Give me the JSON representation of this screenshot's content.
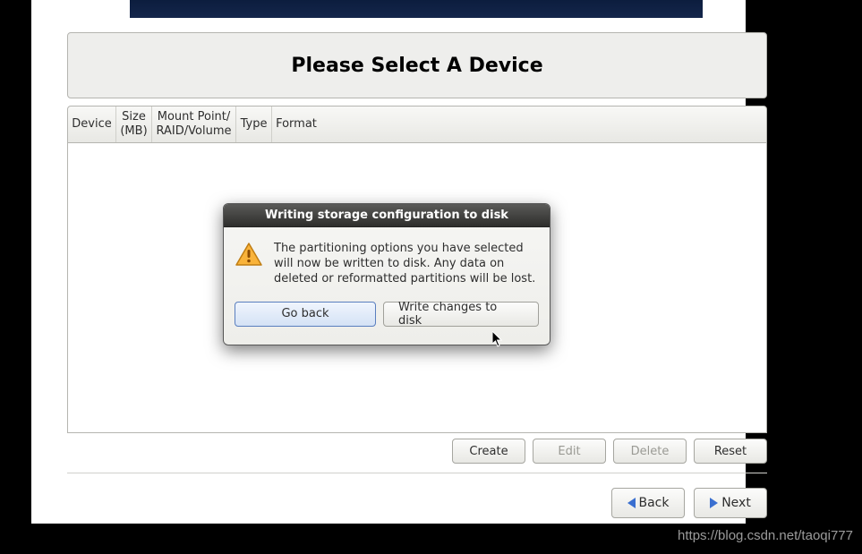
{
  "page": {
    "title": "Please Select A Device"
  },
  "table": {
    "headers": {
      "device": "Device",
      "size": "Size (MB)",
      "mount": "Mount Point/ RAID/Volume",
      "type": "Type",
      "format": "Format"
    }
  },
  "actions": {
    "create": "Create",
    "edit": "Edit",
    "delete": "Delete",
    "reset": "Reset"
  },
  "nav": {
    "back": "Back",
    "next": "Next"
  },
  "modal": {
    "title": "Writing storage configuration to disk",
    "body": "The partitioning options you have selected will now be written to disk.  Any data on deleted or reformatted partitions will be lost.",
    "go_back": "Go back",
    "write": "Write changes to disk"
  },
  "watermark": "https://blog.csdn.net/taoqi777"
}
